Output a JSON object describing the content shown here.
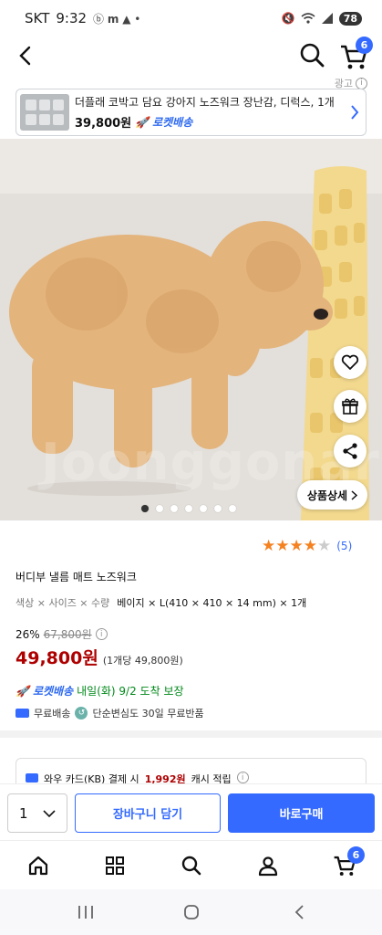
{
  "status_bar": {
    "carrier": "SKT",
    "time": "9:32",
    "battery": "78"
  },
  "nav": {
    "cart_count": "6"
  },
  "ad": {
    "label": "광고",
    "title": "더플래 코박고 담요 강아지 노즈워크 장난감, 디럭스, 1개",
    "price": "39,800원",
    "delivery": "로켓배송"
  },
  "gallery": {
    "watermark": "Joonggonara",
    "detail_button": "상품상세",
    "page_count": 7,
    "current_page": 1
  },
  "product": {
    "rating": 4,
    "rating_max": 5,
    "review_count": "(5)",
    "name": "버디부 낼름 매트 노즈워크",
    "option_keys": "색상 × 사이즈 × 수량",
    "option_values": "베이지 × L(410 × 410 × 14 mm) × 1개",
    "discount": "26%",
    "original_price": "67,800원",
    "price": "49,800원",
    "unit_price": "(1개당 49,800원)",
    "rocket_label": "로켓배송",
    "delivery_date": "내일(화) 9/2 도착 보장",
    "free_shipping": "무료배송",
    "return_policy": "단순변심도 30일 무료반품"
  },
  "promo": {
    "card_text_prefix": "와우 카드(KB) 결제 시",
    "cashback": "1,992원",
    "card_text_suffix": "캐시 적립"
  },
  "buy_bar": {
    "quantity": "1",
    "cart_button": "장바구니 담기",
    "buy_button": "바로구매"
  },
  "bottom_nav": {
    "cart_count": "6"
  },
  "colors": {
    "accent": "#346aff",
    "price": "#ae0000",
    "delivery_green": "#00891a",
    "star": "#f5811f"
  }
}
